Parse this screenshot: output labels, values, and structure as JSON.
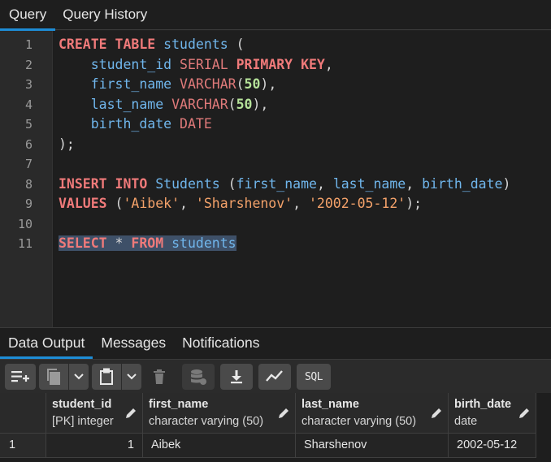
{
  "top_tabs": [
    {
      "label": "Query",
      "active": true
    },
    {
      "label": "Query History",
      "active": false
    }
  ],
  "editor": {
    "line_numbers": [
      "1",
      "2",
      "3",
      "4",
      "5",
      "6",
      "7",
      "8",
      "9",
      "10",
      "11"
    ],
    "lines": [
      [
        [
          "kw",
          "CREATE"
        ],
        [
          "pun",
          " "
        ],
        [
          "kw",
          "TABLE"
        ],
        [
          "pun",
          " "
        ],
        [
          "id",
          "students"
        ],
        [
          "pun",
          " ("
        ]
      ],
      [
        [
          "pun",
          "    "
        ],
        [
          "id",
          "student_id"
        ],
        [
          "pun",
          " "
        ],
        [
          "ty",
          "SERIAL"
        ],
        [
          "pun",
          " "
        ],
        [
          "kw",
          "PRIMARY"
        ],
        [
          "pun",
          " "
        ],
        [
          "kw",
          "KEY"
        ],
        [
          "pun",
          ","
        ]
      ],
      [
        [
          "pun",
          "    "
        ],
        [
          "id",
          "first_name"
        ],
        [
          "pun",
          " "
        ],
        [
          "ty",
          "VARCHAR"
        ],
        [
          "pun",
          "("
        ],
        [
          "num",
          "50"
        ],
        [
          "pun",
          "),"
        ]
      ],
      [
        [
          "pun",
          "    "
        ],
        [
          "id",
          "last_name"
        ],
        [
          "pun",
          " "
        ],
        [
          "ty",
          "VARCHAR"
        ],
        [
          "pun",
          "("
        ],
        [
          "num",
          "50"
        ],
        [
          "pun",
          "),"
        ]
      ],
      [
        [
          "pun",
          "    "
        ],
        [
          "id",
          "birth_date"
        ],
        [
          "pun",
          " "
        ],
        [
          "ty",
          "DATE"
        ]
      ],
      [
        [
          "pun",
          ");"
        ]
      ],
      [],
      [
        [
          "kw",
          "INSERT"
        ],
        [
          "pun",
          " "
        ],
        [
          "kw",
          "INTO"
        ],
        [
          "pun",
          " "
        ],
        [
          "id",
          "Students"
        ],
        [
          "pun",
          " ("
        ],
        [
          "id",
          "first_name"
        ],
        [
          "pun",
          ", "
        ],
        [
          "id",
          "last_name"
        ],
        [
          "pun",
          ", "
        ],
        [
          "id",
          "birth_date"
        ],
        [
          "pun",
          ")"
        ]
      ],
      [
        [
          "kw",
          "VALUES"
        ],
        [
          "pun",
          " ("
        ],
        [
          "str",
          "'Aibek'"
        ],
        [
          "pun",
          ", "
        ],
        [
          "str",
          "'Sharshenov'"
        ],
        [
          "pun",
          ", "
        ],
        [
          "str",
          "'2002-05-12'"
        ],
        [
          "pun",
          ");"
        ]
      ],
      [],
      [
        [
          "kw",
          "SELECT"
        ],
        [
          "pun",
          " * "
        ],
        [
          "kw",
          "FROM"
        ],
        [
          "pun",
          " "
        ],
        [
          "id",
          "students"
        ]
      ]
    ],
    "selected_line": 11
  },
  "bottom_tabs": [
    {
      "label": "Data Output",
      "active": true
    },
    {
      "label": "Messages",
      "active": false
    },
    {
      "label": "Notifications",
      "active": false
    }
  ],
  "toolbar": {
    "sql_label": "SQL",
    "icons": [
      "add-row-icon",
      "copy-icon",
      "chevron-down-icon",
      "paste-icon",
      "chevron-down-icon",
      "delete-icon",
      "save-data-icon",
      "download-icon",
      "graph-icon",
      "sql-icon"
    ]
  },
  "grid": {
    "columns": [
      {
        "name": "student_id",
        "type": "[PK] integer"
      },
      {
        "name": "first_name",
        "type": "character varying (50)"
      },
      {
        "name": "last_name",
        "type": "character varying (50)"
      },
      {
        "name": "birth_date",
        "type": "date"
      }
    ],
    "rows": [
      {
        "row_number": "1",
        "cells": [
          "1",
          "Aibek",
          "Sharshenov",
          "2002-05-12"
        ]
      }
    ]
  },
  "colors": {
    "accent": "#1e8dd6",
    "keyword": "#f07a7a",
    "identifier": "#70b6ec",
    "number": "#b6e39a",
    "string": "#f4a26a",
    "selection": "#3e5068"
  }
}
